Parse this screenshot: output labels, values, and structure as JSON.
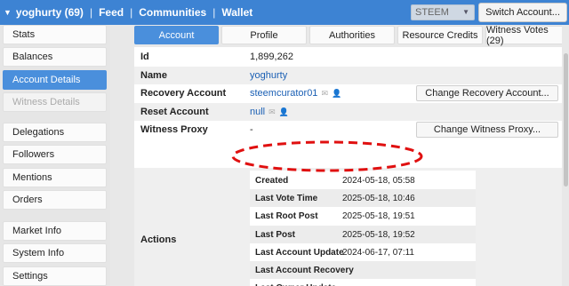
{
  "topbar": {
    "user": "yoghurty (69)",
    "nav": [
      "Feed",
      "Communities",
      "Wallet"
    ],
    "chain": "STEEM",
    "switch_account": "Switch Account..."
  },
  "sidebar": {
    "items": [
      {
        "label": "Stats",
        "state": "normal"
      },
      {
        "label": "Balances",
        "state": "normal"
      },
      {
        "label": "Account Details",
        "state": "active"
      },
      {
        "label": "Witness Details",
        "state": "disabled"
      },
      {
        "label": "Delegations",
        "state": "normal"
      },
      {
        "label": "Followers",
        "state": "normal"
      },
      {
        "label": "Mentions",
        "state": "normal"
      },
      {
        "label": "Orders",
        "state": "normal"
      },
      {
        "label": "Market Info",
        "state": "normal"
      },
      {
        "label": "System Info",
        "state": "normal"
      },
      {
        "label": "Settings",
        "state": "normal"
      }
    ]
  },
  "tabs": [
    "Account",
    "Profile",
    "Authorities",
    "Resource Credits",
    "Witness Votes (29)"
  ],
  "details": {
    "id_label": "Id",
    "id_value": "1,899,262",
    "name_label": "Name",
    "name_value": "yoghurty",
    "recovery_label": "Recovery Account",
    "recovery_value": "steemcurator01",
    "recovery_button": "Change Recovery Account...",
    "reset_label": "Reset Account",
    "reset_value": "null",
    "proxy_label": "Witness Proxy",
    "proxy_value": "-",
    "proxy_button": "Change Witness Proxy...",
    "actions_label": "Actions"
  },
  "actions": [
    {
      "key": "Created",
      "value": "2024-05-18, 05:58"
    },
    {
      "key": "Last Vote Time",
      "value": "2025-05-18, 10:46"
    },
    {
      "key": "Last Root Post",
      "value": "2025-05-18, 19:51"
    },
    {
      "key": "Last Post",
      "value": "2025-05-18, 19:52"
    },
    {
      "key": "Last Account Update",
      "value": "2024-06-17, 07:11"
    },
    {
      "key": "Last Account Recovery",
      "value": "-"
    },
    {
      "key": "Last Owner Update",
      "value": "-"
    }
  ],
  "colors": {
    "accent": "#3d83d3",
    "highlight_annotation": "#e01010"
  },
  "icons": {
    "mail": "mail-icon",
    "user": "user-icon",
    "caret": "caret-down-icon"
  }
}
